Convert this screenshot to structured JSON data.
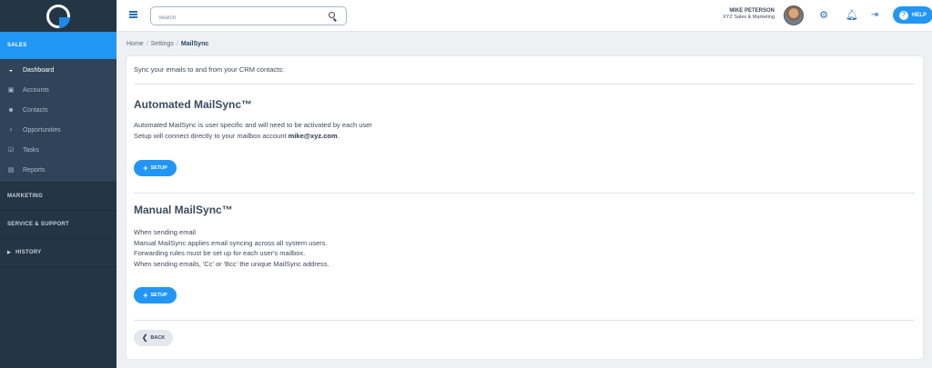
{
  "sidebar": {
    "sections": {
      "sales": "SALES",
      "marketing": "MARKETING",
      "service": "SERVICE & SUPPORT",
      "history": "HISTORY"
    },
    "items": [
      {
        "label": "Dashboard",
        "icon": "dashboard-icon"
      },
      {
        "label": "Accounts",
        "icon": "accounts-icon"
      },
      {
        "label": "Contacts",
        "icon": "contacts-icon"
      },
      {
        "label": "Opportunities",
        "icon": "opportunities-icon"
      },
      {
        "label": "Tasks",
        "icon": "tasks-icon"
      },
      {
        "label": "Reports",
        "icon": "reports-icon"
      }
    ],
    "active_color": "#2196f3",
    "bg_color": "#243546"
  },
  "topbar": {
    "search_placeholder": "Search",
    "user_name": "MIKE PETERSON",
    "user_company": "XYZ Sales & Marketing",
    "help_label": "HELP",
    "accent": "#2196f3"
  },
  "breadcrumb": {
    "home": "Home",
    "settings": "Settings",
    "current": "MailSync"
  },
  "content": {
    "intro": "Sync your emails to and from your CRM contacts:",
    "automated": {
      "title": "Automated MailSync™",
      "line1": "Automated MailSync is user specific and will need to be activated by each user",
      "line2_prefix": "Setup will connect directly to your mailbox account ",
      "email": "mike@xyz.com",
      "line2_suffix": ".",
      "button": "SETUP"
    },
    "manual": {
      "title": "Manual MailSync™",
      "lines": [
        "When sending email",
        "Manual MailSync applies email syncing across all system users.",
        "Forwarding rules must be set up for each user's mailbox.",
        "When sending emails, 'Cc' or 'Bcc' the unique MailSync address."
      ],
      "button": "SETUP"
    },
    "back": "BACK"
  }
}
